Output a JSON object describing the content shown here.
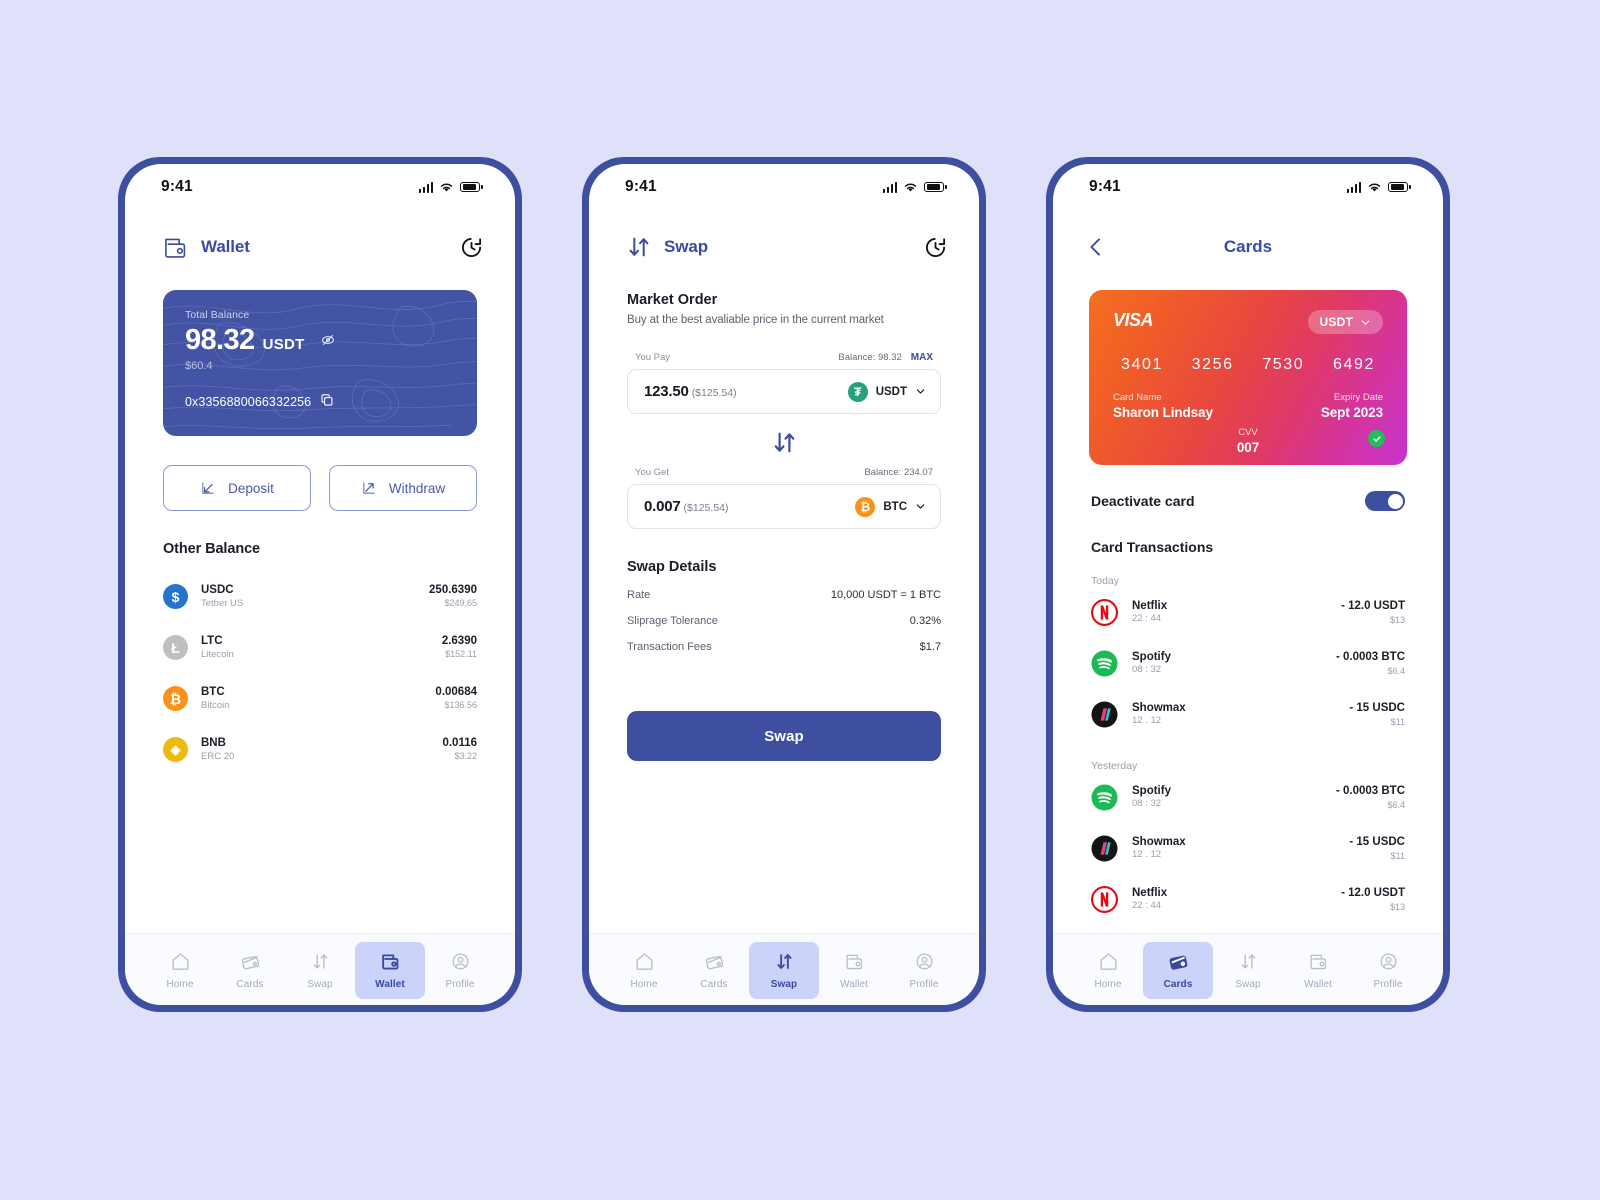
{
  "status_bar": {
    "time": "9:41"
  },
  "screen_wallet": {
    "header": {
      "title": "Wallet",
      "wallet_icon": "wallet-icon",
      "history_icon": "history-icon"
    },
    "balance_card": {
      "label": "Total Balance",
      "amount": "98.32",
      "currency": "USDT",
      "usd": "$60.4",
      "address": "0x3356880066332256",
      "copy_icon": "copy-icon",
      "hide_icon": "eye-slash-icon",
      "bg_color": "#4354a4"
    },
    "actions": [
      {
        "label": "Deposit",
        "icon": "arrow-down-left-icon"
      },
      {
        "label": "Withdraw",
        "icon": "arrow-up-right-icon"
      }
    ],
    "other_balance_title": "Other Balance",
    "coins": [
      {
        "symbol": "USDC",
        "name": "Tether US",
        "amount": "250.6390",
        "usd": "$249.65",
        "color": "#2775ca",
        "glyph": "$"
      },
      {
        "symbol": "LTC",
        "name": "Litecoin",
        "amount": "2.6390",
        "usd": "$152.11",
        "color": "#bfbfbf",
        "glyph": "Ł"
      },
      {
        "symbol": "BTC",
        "name": "Bitcoin",
        "amount": "0.00684",
        "usd": "$136.56",
        "color": "#f7931a",
        "glyph": "₿"
      },
      {
        "symbol": "BNB",
        "name": "ERC 20",
        "amount": "0.0116",
        "usd": "$3.22",
        "color": "#f0b90b",
        "glyph": "◈"
      }
    ],
    "tabs": [
      {
        "label": "Home",
        "icon": "home-icon",
        "active": false
      },
      {
        "label": "Cards",
        "icon": "cards-icon",
        "active": false
      },
      {
        "label": "Swap",
        "icon": "swap-icon",
        "active": false
      },
      {
        "label": "Wallet",
        "icon": "wallet-icon",
        "active": true
      },
      {
        "label": "Profile",
        "icon": "profile-icon",
        "active": false
      }
    ]
  },
  "screen_swap": {
    "header": {
      "title": "Swap",
      "swap_icon": "swap-arrows-icon",
      "history_icon": "history-icon"
    },
    "market_order": {
      "title": "Market Order",
      "subtitle": "Buy at the best avaliable price in the current market"
    },
    "pay": {
      "label": "You Pay",
      "balance": "Balance: 98.32",
      "max": "MAX",
      "value": "123.50",
      "value_usd": "($125.54)",
      "token": "USDT",
      "token_color": "#26a17b",
      "token_glyph": "₮",
      "chevron_icon": "chevron-down-icon"
    },
    "switch_icon": "swap-arrows-icon",
    "get": {
      "label": "You Get",
      "balance": "Balance: 234.07",
      "value": "0.007",
      "value_usd": "($125.54)",
      "token": "BTC",
      "token_color": "#f7931a",
      "token_glyph": "₿",
      "chevron_icon": "chevron-down-icon"
    },
    "details": {
      "title": "Swap Details",
      "rows": [
        {
          "key": "Rate",
          "value": "10,000 USDT = 1 BTC"
        },
        {
          "key": "Sliprage Tolerance",
          "value": "0.32%"
        },
        {
          "key": "Transaction Fees",
          "value": "$1.7"
        }
      ]
    },
    "cta": "Swap",
    "tabs": [
      {
        "label": "Home",
        "icon": "home-icon",
        "active": false
      },
      {
        "label": "Cards",
        "icon": "cards-icon",
        "active": false
      },
      {
        "label": "Swap",
        "icon": "swap-icon",
        "active": true
      },
      {
        "label": "Wallet",
        "icon": "wallet-icon",
        "active": false
      },
      {
        "label": "Profile",
        "icon": "profile-icon",
        "active": false
      }
    ]
  },
  "screen_cards": {
    "header": {
      "title": "Cards",
      "back_icon": "chevron-left-icon"
    },
    "card": {
      "brand": "VISA",
      "currency": "USDT",
      "chevron_icon": "chevron-down-icon",
      "number_groups": [
        "3401",
        "3256",
        "7530",
        "6492"
      ],
      "name_label": "Card Name",
      "name_value": "Sharon Lindsay",
      "expiry_label": "Expiry Date",
      "expiry_value": "Sept 2023",
      "cvv_label": "CVV",
      "cvv_value": "007",
      "verified_icon": "check-circle-icon",
      "gradient_from": "#f4701f",
      "gradient_to": "#c734cf"
    },
    "deactivate": {
      "label": "Deactivate card",
      "on": true
    },
    "transactions_title": "Card Transactions",
    "groups": [
      {
        "label": "Today",
        "items": [
          {
            "name": "Netflix",
            "time": "22 : 44",
            "amount": "-  12.0 USDT",
            "usd": "$13",
            "icon": "netflix-icon",
            "color": "#e50914"
          },
          {
            "name": "Spotify",
            "time": "08 : 32",
            "amount": "-  0.0003 BTC",
            "usd": "$6.4",
            "icon": "spotify-icon",
            "color": "#1db954"
          },
          {
            "name": "Showmax",
            "time": "12 . 12",
            "amount": "-  15 USDC",
            "usd": "$11",
            "icon": "showmax-icon",
            "color": "#141414"
          }
        ]
      },
      {
        "label": "Yesterday",
        "items": [
          {
            "name": "Spotify",
            "time": "08 : 32",
            "amount": "-  0.0003 BTC",
            "usd": "$6.4",
            "icon": "spotify-icon",
            "color": "#1db954"
          },
          {
            "name": "Showmax",
            "time": "12 . 12",
            "amount": "-  15 USDC",
            "usd": "$11",
            "icon": "showmax-icon",
            "color": "#141414"
          },
          {
            "name": "Netflix",
            "time": "22 : 44",
            "amount": "-  12.0 USDT",
            "usd": "$13",
            "icon": "netflix-icon",
            "color": "#e50914"
          }
        ]
      }
    ],
    "tabs": [
      {
        "label": "Home",
        "icon": "home-icon",
        "active": false
      },
      {
        "label": "Cards",
        "icon": "cards-icon",
        "active": true
      },
      {
        "label": "Swap",
        "icon": "swap-icon",
        "active": false
      },
      {
        "label": "Wallet",
        "icon": "wallet-icon",
        "active": false
      },
      {
        "label": "Profile",
        "icon": "profile-icon",
        "active": false
      }
    ]
  }
}
